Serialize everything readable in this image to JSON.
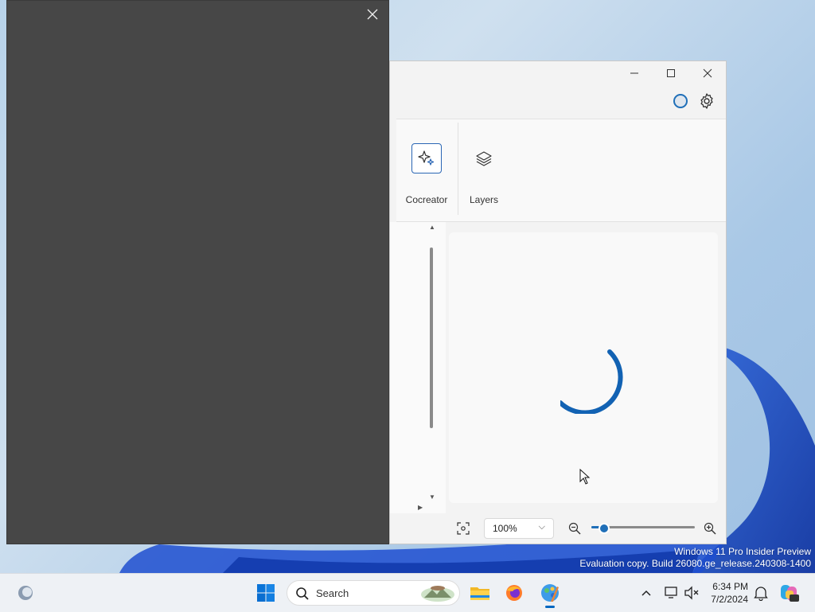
{
  "ribbon": {
    "tools": [
      {
        "label": "Cocreator",
        "icon": "sparkle-icon",
        "active": true
      },
      {
        "label": "Layers",
        "icon": "layers-icon",
        "active": false
      }
    ]
  },
  "bottom_bar": {
    "zoom_value": "100%",
    "zoom_slider_fraction": 0.12
  },
  "overlay": {
    "close_icon": "close-icon"
  },
  "watermark": {
    "line1": "Windows 11 Pro Insider Preview",
    "line2": "Evaluation copy. Build 26080.ge_release.240308-1400"
  },
  "taskbar": {
    "search_label": "Search",
    "time": "6:34 PM",
    "date": "7/2/2024",
    "icons": [
      "widgets-icon",
      "windows-start-icon",
      "search-icon",
      "file-explorer-icon",
      "firefox-icon",
      "paint-icon",
      "chevron-up-icon",
      "network-icon",
      "volume-mute-icon",
      "notification-bell-icon",
      "copilot-icon"
    ]
  },
  "colors": {
    "accent": "#1f6fb8",
    "overlay": "#474747",
    "taskbar": "#eef1f5"
  }
}
